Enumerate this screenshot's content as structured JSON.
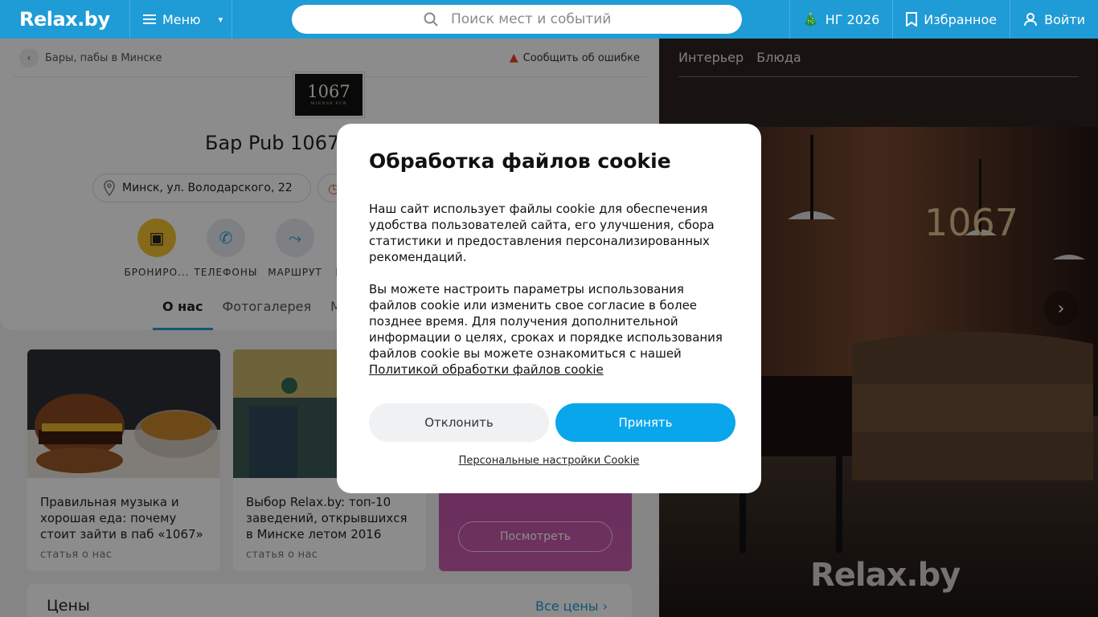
{
  "header": {
    "logo": "Relax.by",
    "menu_label": "Меню",
    "search_placeholder": "Поиск мест и событий",
    "ny_label": "НГ 2026",
    "favorites_label": "Избранное",
    "login_label": "Войти"
  },
  "breadcrumb": {
    "label": "Бары, пабы в Минске"
  },
  "report_label": "Сообщить об ошибке",
  "venue": {
    "logo_text": "1067",
    "logo_sub": "MIENSK PUB",
    "title": "Бар Pub 1067",
    "address": "Минск, ул. Володарского, 22"
  },
  "actions": [
    {
      "label": "БРОНИРО..."
    },
    {
      "label": "ТЕЛЕФОНЫ"
    },
    {
      "label": "МАРШРУТ"
    },
    {
      "label": "В"
    }
  ],
  "tabs": [
    {
      "label": "О нас"
    },
    {
      "label": "Фотогалерея"
    },
    {
      "label": "Ме"
    }
  ],
  "articles": [
    {
      "title": "Правильная музыка и хорошая еда: почему стоит зайти в паб «1067»",
      "subtitle": "статья о нас"
    },
    {
      "title": "Выбор Relax.by: топ-10 заведений, открывшихся в Минске летом 2016",
      "subtitle": "статья о нас"
    }
  ],
  "promo": {
    "button_label": "Посмотреть"
  },
  "prices": {
    "title": "Цены",
    "all_label": "Все цены"
  },
  "photo": {
    "tabs": [
      "Интерьер",
      "Блюда"
    ],
    "watermark": "Relax.by"
  },
  "cookie": {
    "title": "Обработка файлов cookie",
    "para1": "Наш сайт использует файлы cookie для обеспечения удобства пользователей сайта, его улучшения, сбора статистики и предоставления персонализированных рекомендаций.",
    "para2": "Вы можете настроить параметры использования файлов cookie или изменить свое согласие в более позднее время. Для получения дополнительной информации о целях, сроках и порядке использования файлов cookie вы можете ознакомиться с нашей ",
    "policy_link": "Политикой обработки файлов cookie",
    "decline_label": "Отклонить",
    "accept_label": "Принять",
    "personal_label": "Персональные настройки Cookie"
  },
  "colors": {
    "brand": "#1f9bd6",
    "accept": "#0aa6ec",
    "booking_accent": "#f2c230",
    "promo": "#b8479f"
  }
}
